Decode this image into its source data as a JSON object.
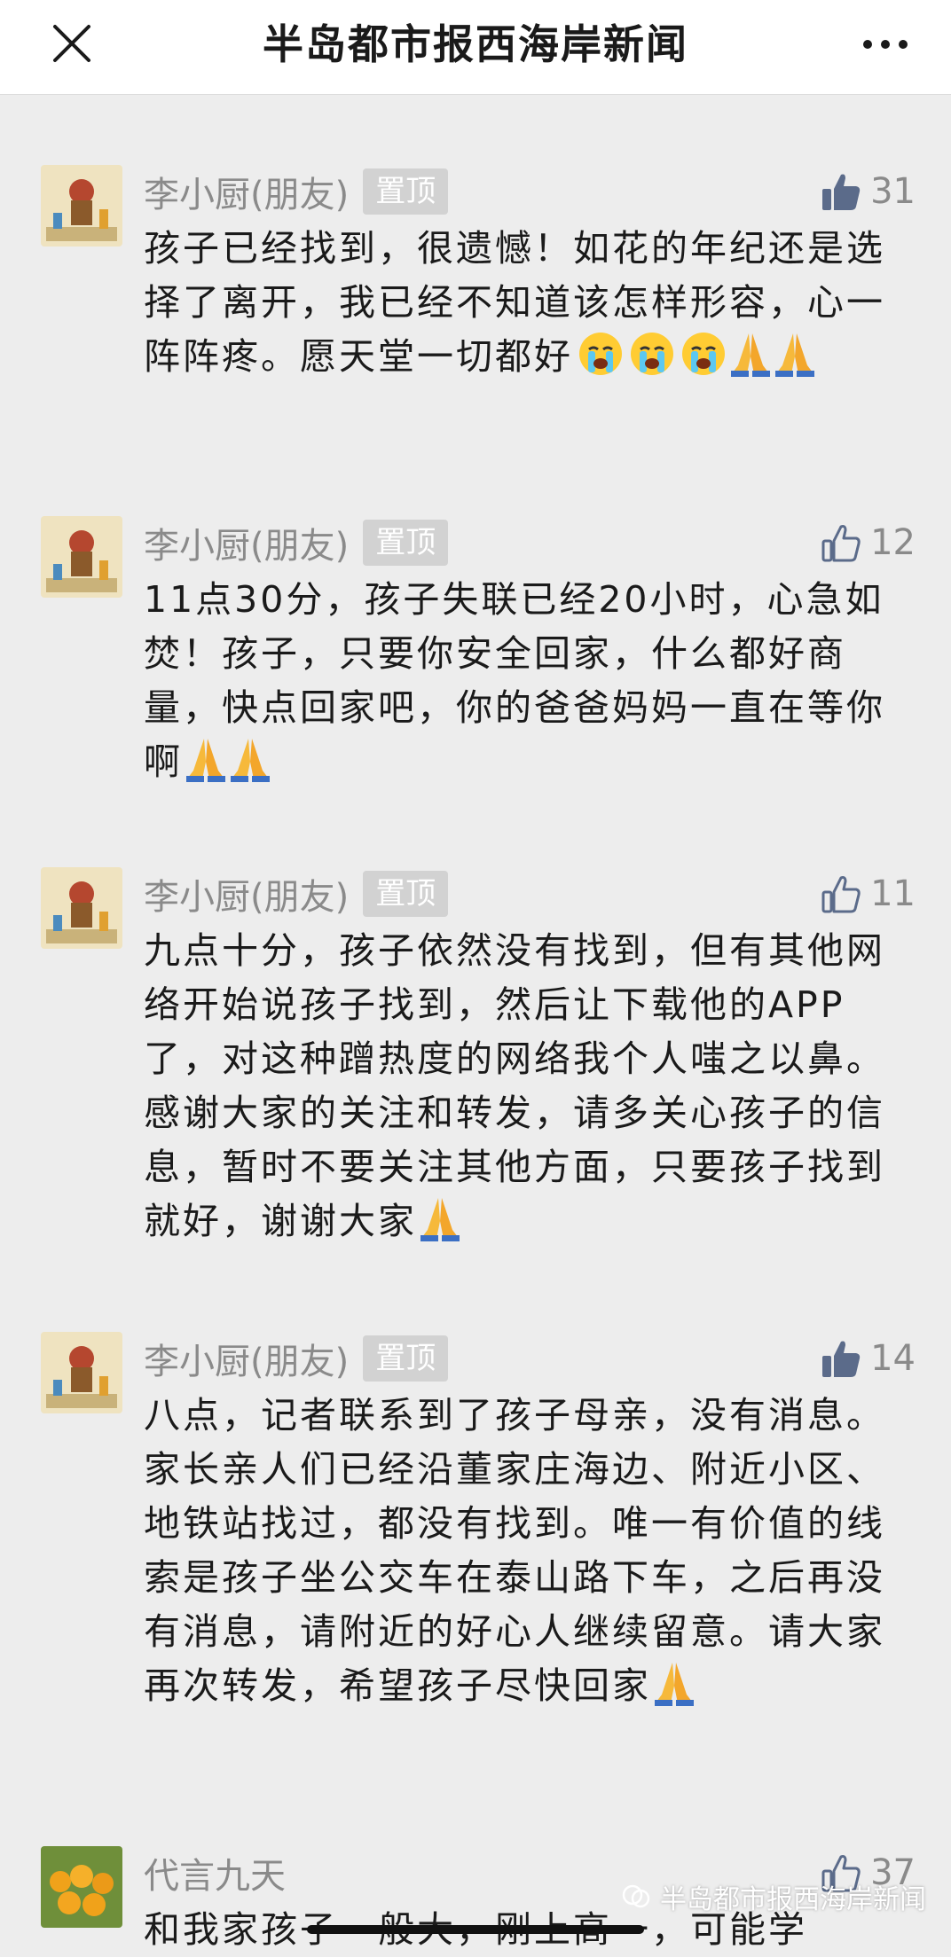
{
  "header": {
    "title": "半岛都市报西海岸新闻",
    "close_icon": "close-icon",
    "more_icon": "more-icon"
  },
  "comments": [
    {
      "name": "李小厨(朋友)",
      "pin_label": "置顶",
      "likes": "31",
      "liked": true,
      "text": "孩子已经找到，很遗憾！如花的年纪还是选择了离开，我已经不知道该怎样形容，心一阵阵疼。愿天堂一切都好",
      "emojis": [
        "crying-face-emoji",
        "crying-face-emoji",
        "crying-face-emoji",
        "folded-hands-emoji",
        "folded-hands-emoji"
      ]
    },
    {
      "name": "李小厨(朋友)",
      "pin_label": "置顶",
      "likes": "12",
      "liked": false,
      "text": "11点30分，孩子失联已经20小时，心急如焚！孩子，只要你安全回家，什么都好商量，快点回家吧，你的爸爸妈妈一直在等你啊",
      "emojis": [
        "folded-hands-emoji",
        "folded-hands-emoji"
      ]
    },
    {
      "name": "李小厨(朋友)",
      "pin_label": "置顶",
      "likes": "11",
      "liked": false,
      "text": "九点十分，孩子依然没有找到，但有其他网络开始说孩子找到，然后让下载他的APP了，对这种蹭热度的网络我个人嗤之以鼻。感谢大家的关注和转发，请多关心孩子的信息，暂时不要关注其他方面，只要孩子找到就好，谢谢大家",
      "emojis": [
        "folded-hands-emoji"
      ]
    },
    {
      "name": "李小厨(朋友)",
      "pin_label": "置顶",
      "likes": "14",
      "liked": true,
      "text": "八点，记者联系到了孩子母亲，没有消息。家长亲人们已经沿董家庄海边、附近小区、地铁站找过，都没有找到。唯一有价值的线索是孩子坐公交车在泰山路下车，之后再没有消息，请附近的好心人继续留意。请大家再次转发，希望孩子尽快回家",
      "emojis": [
        "folded-hands-emoji"
      ]
    },
    {
      "name": "代言九天",
      "pin_label": "",
      "likes": "37",
      "liked": false,
      "text": "和我家孩子一般大，刚上高一，可能学",
      "emojis": []
    }
  ],
  "watermark": {
    "text": "半岛都市报西海岸新闻",
    "icon": "wechat-channel-icon"
  },
  "colors": {
    "background": "#ededed",
    "header_bg": "#ffffff",
    "name_gray": "#8a8a8a",
    "pin_bg": "#d2d2d2",
    "liked_blue": "#5b6b8a",
    "text": "#1a1a1a"
  }
}
